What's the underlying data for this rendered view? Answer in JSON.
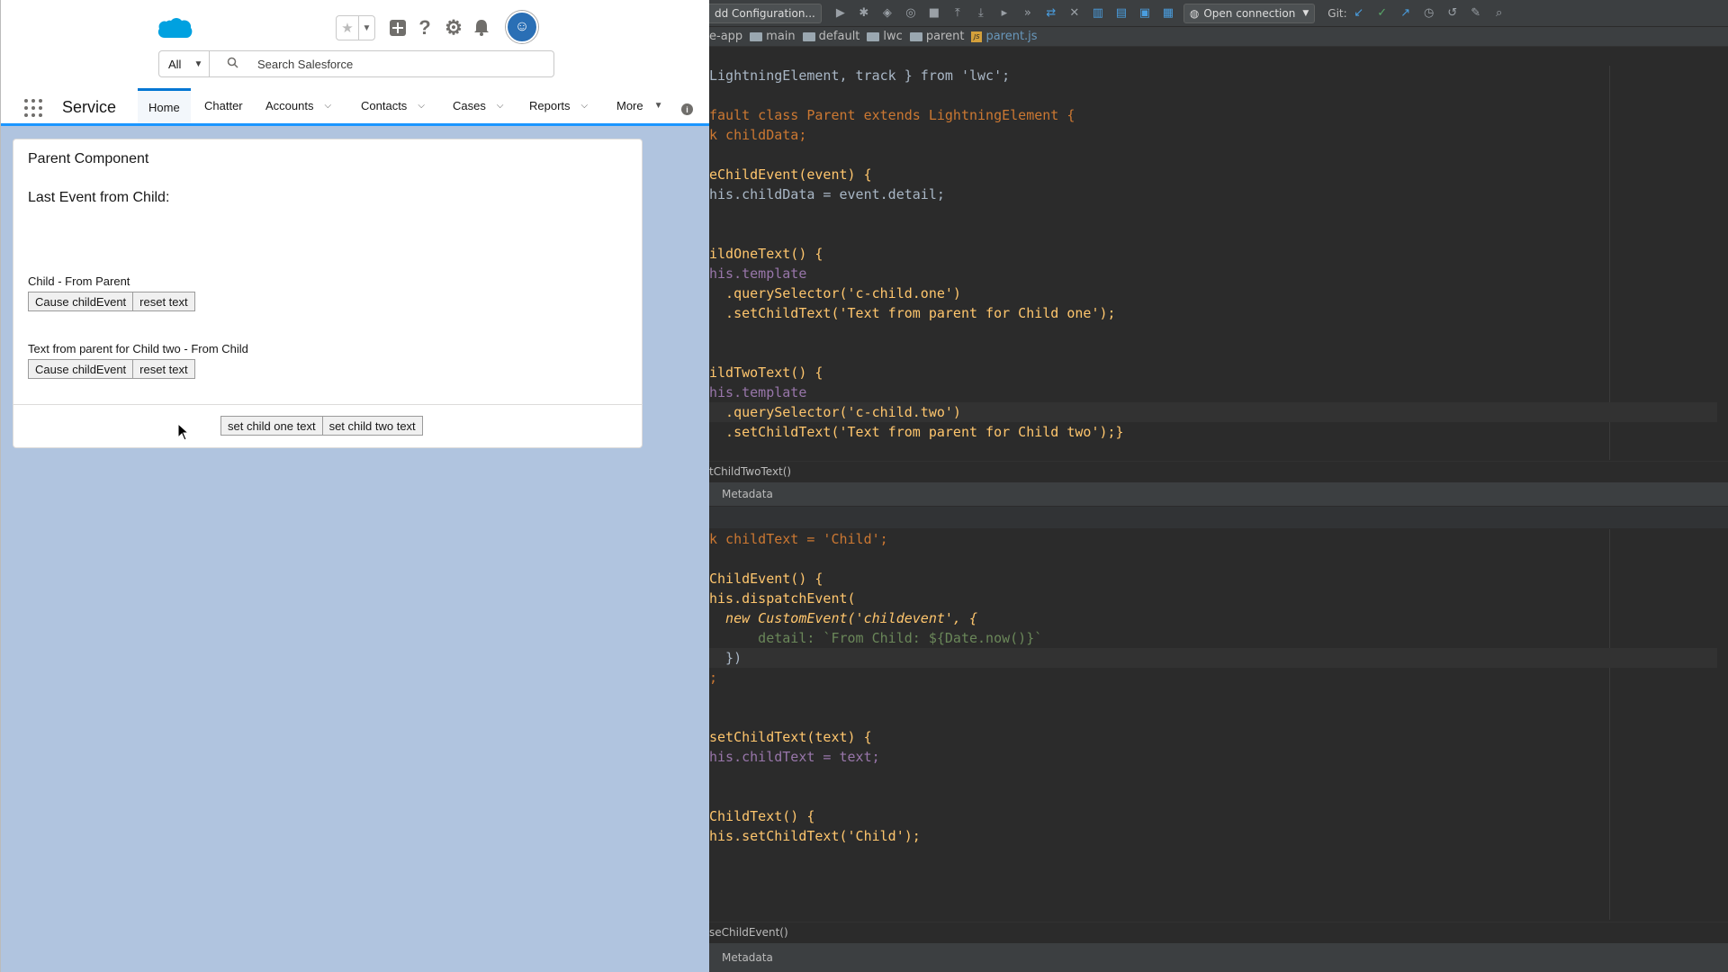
{
  "salesforce": {
    "search": {
      "scope": "All",
      "placeholder": "Search Salesforce"
    },
    "app_name": "Service",
    "nav": [
      {
        "label": "Home",
        "active": true,
        "dropdown": false
      },
      {
        "label": "Chatter",
        "active": false,
        "dropdown": false
      },
      {
        "label": "Accounts",
        "active": false,
        "dropdown": true
      },
      {
        "label": "Contacts",
        "active": false,
        "dropdown": true
      },
      {
        "label": "Cases",
        "active": false,
        "dropdown": true
      },
      {
        "label": "Reports",
        "active": false,
        "dropdown": true
      },
      {
        "label": "More",
        "active": false,
        "dropdown": true
      }
    ],
    "card": {
      "title": "Parent Component",
      "last_event_label": "Last Event from Child:",
      "child_one_label": "Child - From Parent",
      "child_two_label": "Text from parent for Child two - From Child",
      "cause_event_label": "Cause childEvent",
      "reset_text_label": "reset text",
      "set_child_one_label": "set child one text",
      "set_child_two_label": "set child two text"
    },
    "icons": [
      "salesforce-cloud-icon",
      "star-icon",
      "add-icon",
      "help-icon",
      "gear-icon",
      "bell-icon",
      "avatar",
      "search-icon",
      "app-launcher-icon",
      "info-icon"
    ],
    "colors": {
      "brand": "#1b96ff",
      "background": "#b0c4df"
    }
  },
  "ide": {
    "toolbar": {
      "run_config": "dd Configuration...",
      "open_connection": "Open connection",
      "git_label": "Git:"
    },
    "breadcrumb": [
      "e-app",
      "main",
      "default",
      "lwc",
      "parent",
      "parent.js"
    ],
    "top_editor": {
      "lines": [
        "LightningElement, track } from 'lwc';",
        "",
        "fault class Parent extends LightningElement {",
        "k childData;",
        "",
        "eChildEvent(event) {",
        "his.childData = event.detail;",
        "",
        "",
        "ildOneText() {",
        "his.template",
        "  .querySelector('c-child.one')",
        "  .setChildText('Text from parent for Child one');",
        "",
        "",
        "ildTwoText() {",
        "his.template",
        "  .querySelector('c-child.two')",
        "  .setChildText('Text from parent for Child two');}"
      ],
      "struct": "tChildTwoText()",
      "tab": "Metadata"
    },
    "bottom_editor": {
      "lines": [
        "k childText = 'Child';",
        "",
        "ChildEvent() {",
        "his.dispatchEvent(",
        "  new CustomEvent('childevent', {",
        "      detail: `From Child: ${Date.now()}`",
        "  })",
        ";",
        "",
        "",
        "setChildText(text) {",
        "his.childText = text;",
        "",
        "",
        "ChildText() {",
        "his.setChildText('Child');"
      ],
      "struct": "seChildEvent()",
      "tab": "Metadata"
    },
    "colors": {
      "background": "#2b2b2b",
      "keyword": "#cc7832",
      "function": "#ffc66d",
      "field": "#9876aa",
      "string": "#6a8759"
    }
  }
}
